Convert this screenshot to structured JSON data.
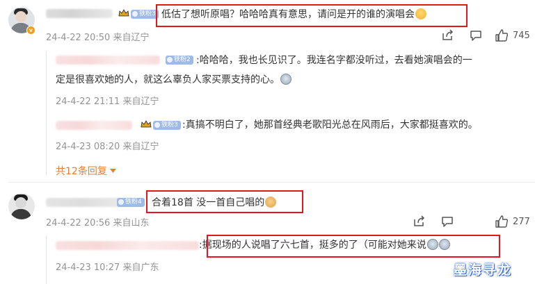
{
  "comments": [
    {
      "fan_badge": "铁粉3",
      "text": "低估了想听原唱？哈哈哈真有意思，请问是开的谁的演唱会",
      "time": "24-4-22 20:50 来自辽宁",
      "likes": "745",
      "replies": [
        {
          "fan_badge": "铁粉2",
          "text_line1": ":哈哈哈，我也长见识了。我连名字都没听过，去看她演唱会的一",
          "text_line2": "定是很喜欢她的人，就这么辜负人家买票支持的心。",
          "time": "24-4-22 21:11 来自辽宁"
        },
        {
          "fan_badge": "铁粉3",
          "text": ":真搞不明白了，她那首经典老歌阳光总在风雨后，大家都挺喜欢的。",
          "time": "24-4-23 08:20 来自辽宁"
        }
      ],
      "more_replies": "共12条回复"
    },
    {
      "fan_badge": "铁粉4",
      "text": "合着18首 没一首自己唱的",
      "time": "24-4-22 20:56 来自山东",
      "likes": "277",
      "replies": [
        {
          "name_fragment": ":",
          "text": "据现场的人说唱了六七首，挺多的了（可能对她来说",
          "time": "24-4-23 10:27 来自广东"
        }
      ]
    }
  ],
  "icons": {
    "share": "share-icon",
    "comment": "comment-icon",
    "like": "thumbs-up-icon",
    "verified": "v-badge-icon",
    "crown": "crown-icon",
    "chevron": "caret-down-icon"
  },
  "colors": {
    "highlight_box": "#e6141b",
    "more_link": "#ef7b2c",
    "meta_text": "#939393",
    "fan_badge": "#9dbbe6"
  },
  "watermark": "墨海寻龙"
}
